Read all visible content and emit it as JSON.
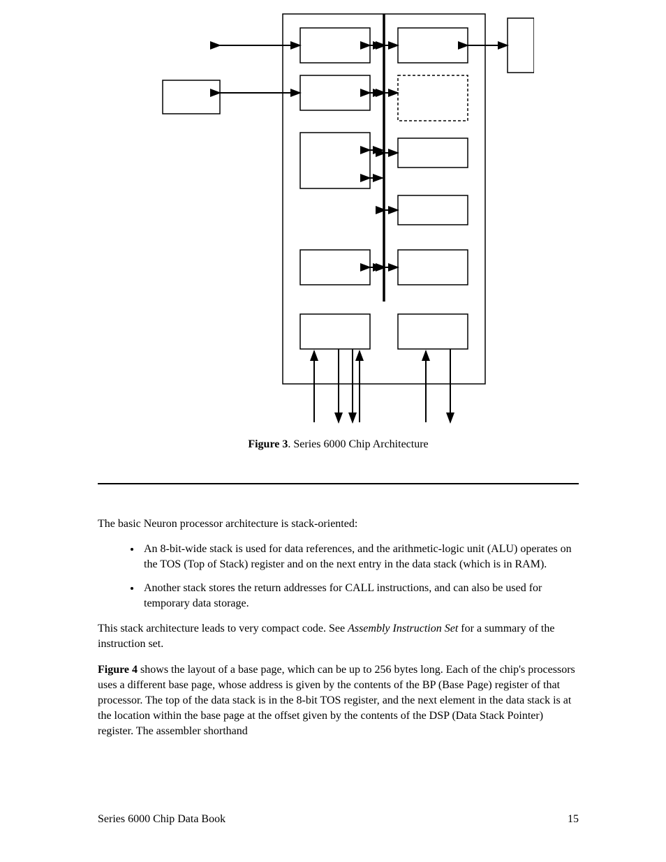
{
  "figure": {
    "label": "Figure 3",
    "caption": ". Series 6000 Chip Architecture"
  },
  "body": {
    "intro": "The basic Neuron processor architecture is stack-oriented:",
    "bullet1": "An 8-bit-wide stack is used for data references, and the arithmetic-logic unit (ALU) operates on the TOS (Top of Stack) register and on the next entry in the data stack (which is in RAM).",
    "bullet2": "Another stack stores the return addresses for CALL instructions, and can also be used for temporary data storage.",
    "para2_a": "This stack architecture leads to very compact code.  See ",
    "para2_em": "Assembly Instruction Set",
    "para2_b": " for a summary of the instruction set.",
    "para3_bold": "Figure 4",
    "para3_rest": " shows the layout of a base page, which can be up to 256 bytes long.  Each of the chip's processors uses a different base page, whose address is given by the contents of the BP (Base Page) register of that processor.  The top of the data stack is in the 8-bit TOS register, and the next element in the data stack is at the location within the base page at the offset given by the contents of the DSP (Data Stack Pointer) register.  The assembler shorthand"
  },
  "footer": {
    "left": "Series 6000 Chip Data Book",
    "right": "15"
  }
}
